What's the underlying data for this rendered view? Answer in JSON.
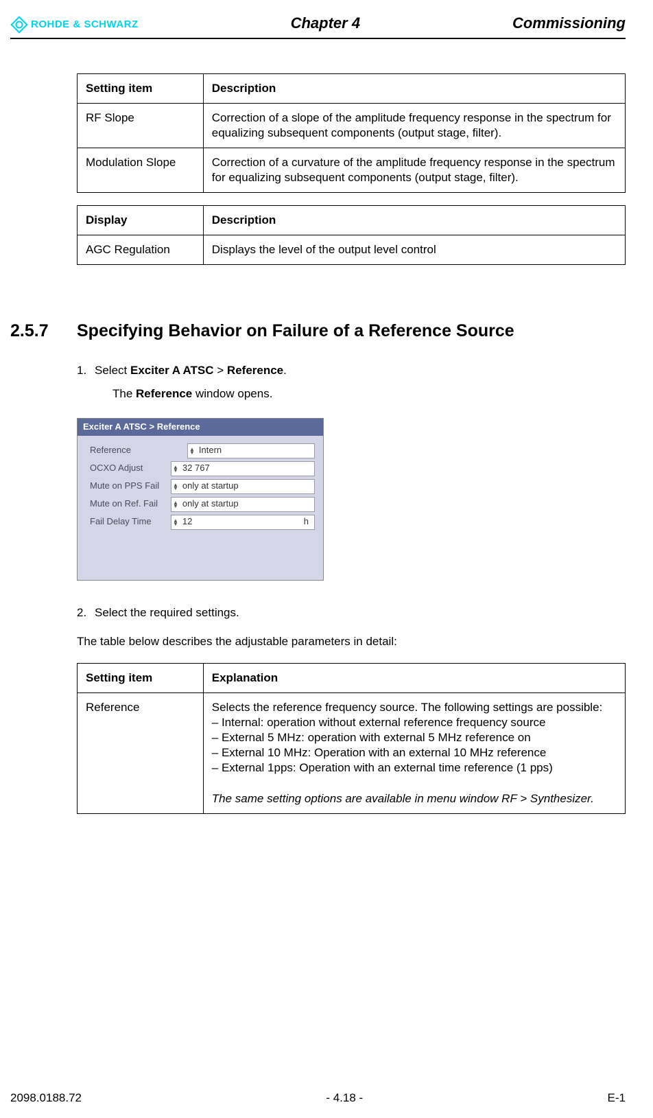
{
  "header": {
    "logo_text": "ROHDE & SCHWARZ",
    "chapter": "Chapter 4",
    "title": "Commissioning"
  },
  "table1": {
    "headers": [
      "Setting item",
      "Description"
    ],
    "rows": [
      {
        "c0": "RF Slope",
        "c1": "Correction of a slope of the amplitude frequency response in the spectrum for equalizing subsequent components (output stage, filter)."
      },
      {
        "c0": "Modulation Slope",
        "c1": "Correction of a curvature of the amplitude frequency response in the spectrum for equalizing subsequent components (output stage, filter)."
      }
    ]
  },
  "table2": {
    "headers": [
      "Display",
      "Description"
    ],
    "rows": [
      {
        "c0": "AGC Regulation",
        "c1": "Displays the level of the output level control"
      }
    ]
  },
  "section": {
    "number": "2.5.7",
    "title": "Specifying Behavior on Failure of a Reference Source"
  },
  "step1": {
    "num": "1.",
    "prefix": "Select ",
    "bold1": "Exciter A ATSC",
    "sep": " > ",
    "bold2": "Reference",
    "suffix": ".",
    "sub_prefix": "The ",
    "sub_bold": "Reference",
    "sub_suffix": " window opens."
  },
  "screenshot": {
    "title": "Exciter A ATSC  >  Reference",
    "rows": [
      {
        "label": "Reference",
        "value": "Intern",
        "suffix": ""
      },
      {
        "label": "OCXO Adjust",
        "value": "32 767",
        "suffix": ""
      },
      {
        "label": "Mute on PPS Fail",
        "value": "only at startup",
        "suffix": ""
      },
      {
        "label": "Mute on Ref. Fail",
        "value": "only at startup",
        "suffix": ""
      },
      {
        "label": "Fail Delay Time",
        "value": "12",
        "suffix": "h"
      }
    ]
  },
  "step2": {
    "num": "2.",
    "text": "Select the required settings."
  },
  "para_after": "The table below describes the adjustable parameters in detail:",
  "table3": {
    "headers": [
      "Setting item",
      "Explanation"
    ],
    "row0": {
      "c0": "Reference",
      "intro": "Selects the reference frequency source. The following settings are possible:",
      "b1": "–  Internal: operation without external reference frequency source",
      "b2": "–  External 5 MHz: operation with external 5 MHz reference on",
      "b3": "–  External 10 MHz: Operation with an external 10 MHz reference",
      "b4": "–  External 1pps: Operation with an external time reference (1 pps)",
      "note": "The same setting options are available in menu window RF > Synthesizer."
    }
  },
  "footer": {
    "left": "2098.0188.72",
    "center": "- 4.18 -",
    "right": "E-1"
  }
}
